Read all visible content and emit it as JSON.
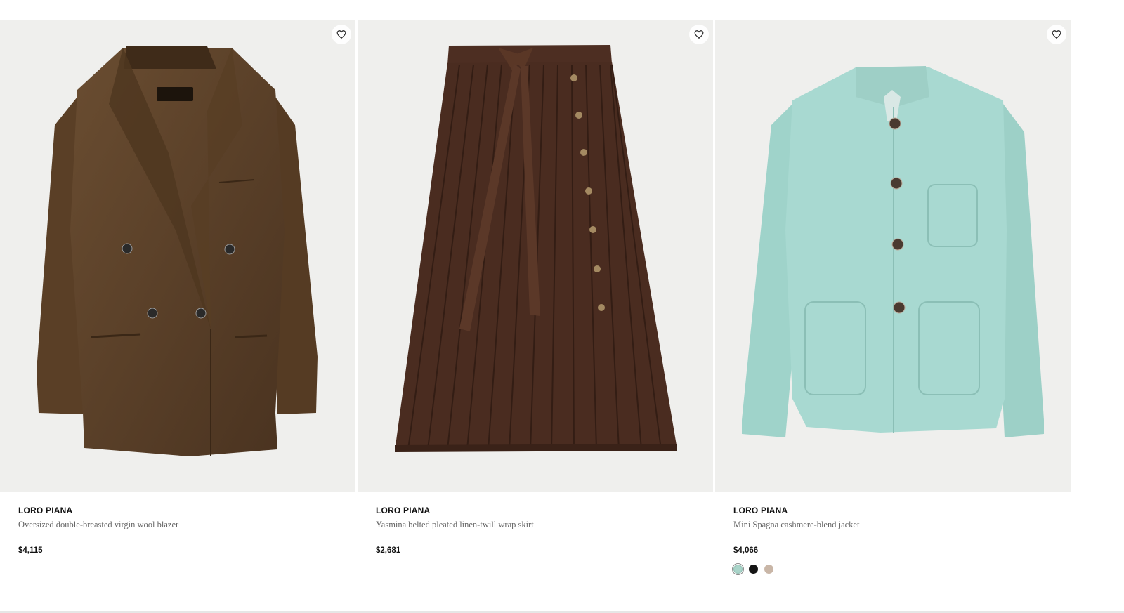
{
  "products": [
    {
      "brand": "LORO PIANA",
      "name": "Oversized double-breasted virgin wool blazer",
      "price": "$4,115",
      "image": "brown-blazer",
      "wishlist_icon": "heart-icon",
      "swatches": []
    },
    {
      "brand": "LORO PIANA",
      "name": "Yasmina belted pleated linen-twill wrap skirt",
      "price": "$2,681",
      "image": "brown-pleated-skirt",
      "wishlist_icon": "heart-icon",
      "swatches": []
    },
    {
      "brand": "LORO PIANA",
      "name": "Mini Spagna cashmere-blend jacket",
      "price": "$4,066",
      "image": "mint-jacket",
      "wishlist_icon": "heart-icon",
      "swatches": [
        {
          "color": "#a9d4c9",
          "selected": true
        },
        {
          "color": "#151515",
          "selected": false
        },
        {
          "color": "#c9b6a7",
          "selected": false
        }
      ]
    }
  ],
  "colors": {
    "image_bg": "#efefed",
    "blazer": "#5b4128",
    "skirt": "#4a2c20",
    "jacket": "#a8d9d1",
    "brand_text": "#111111",
    "name_text": "#666666"
  }
}
